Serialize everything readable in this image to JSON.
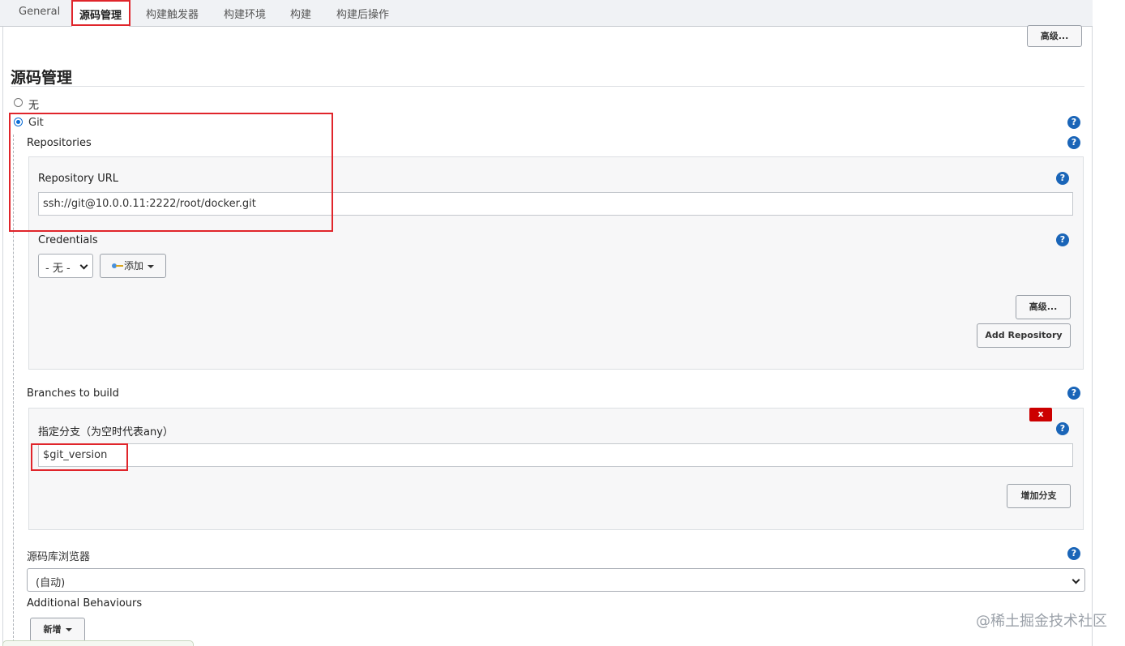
{
  "tabs": [
    "General",
    "源码管理",
    "构建触发器",
    "构建环境",
    "构建",
    "构建后操作"
  ],
  "top_advanced_label": "高级...",
  "section_title": "源码管理",
  "scm_options": {
    "none_label": "无",
    "git_label": "Git"
  },
  "repositories": {
    "label": "Repositories",
    "url_label": "Repository URL",
    "url_value": "ssh://git@10.0.0.11:2222/root/docker.git",
    "credentials_label": "Credentials",
    "credentials_selected": "- 无 -",
    "add_label": "添加",
    "advanced_label": "高级...",
    "add_repository_label": "Add Repository"
  },
  "branches": {
    "label": "Branches to build",
    "delete_label": "x",
    "specifier_label": "指定分支（为空时代表any）",
    "specifier_value": "$git_version",
    "add_branch_label": "增加分支"
  },
  "browser": {
    "label": "源码库浏览器",
    "selected": "(自动)"
  },
  "behaviours": {
    "label": "Additional Behaviours",
    "add_label": "新增"
  },
  "help_glyph": "?",
  "watermark": "@稀土掘金技术社区",
  "colors": {
    "highlight": "#e0252b",
    "help": "#1a65b8",
    "delete": "#cc0000",
    "radio": "#0a6cd6"
  }
}
